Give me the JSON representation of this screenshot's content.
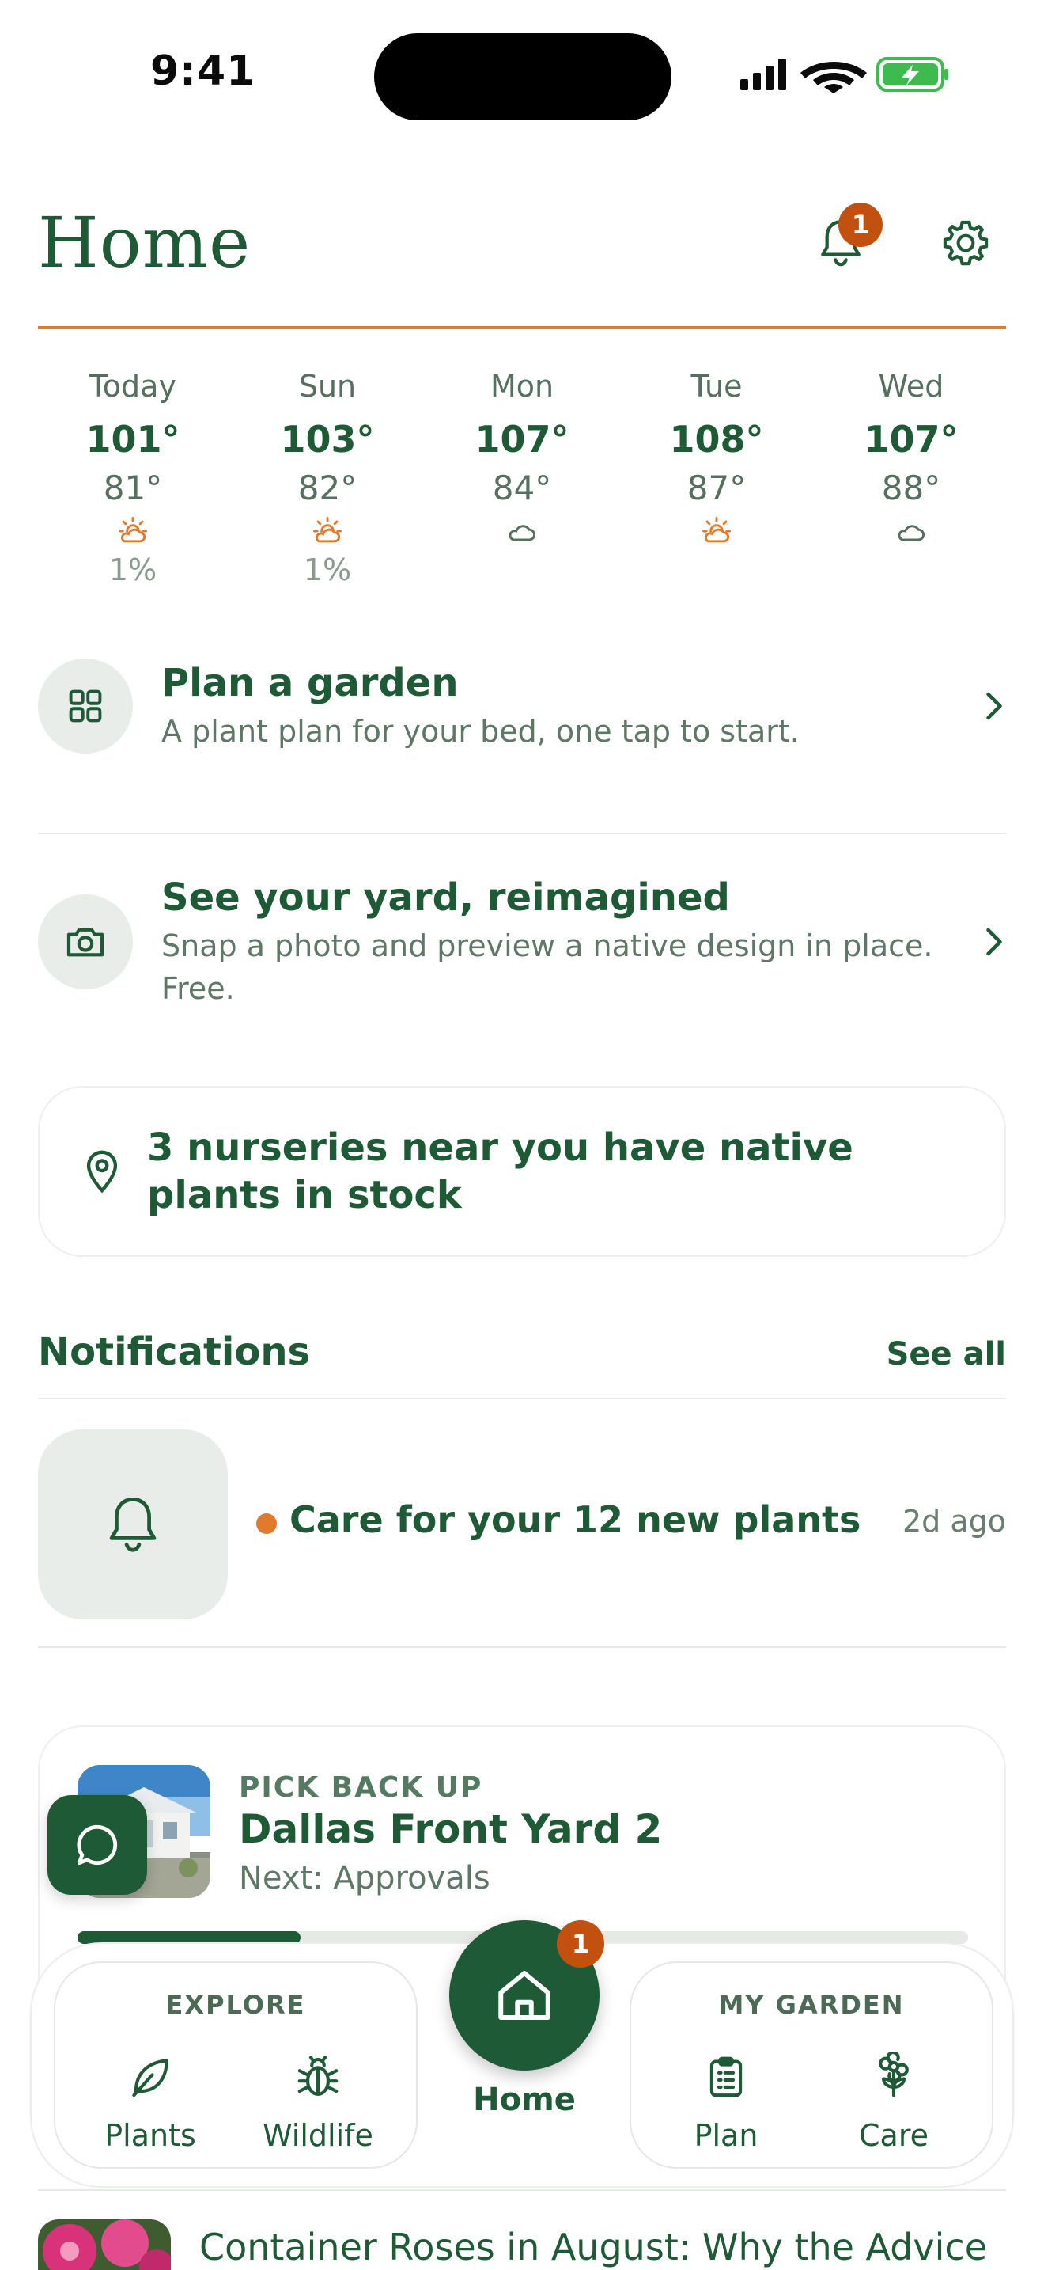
{
  "status_bar": {
    "time": "9:41"
  },
  "header": {
    "title": "Home",
    "notifications_count": "1"
  },
  "weather": [
    {
      "day": "Today",
      "high": "101°",
      "low": "81°",
      "icon": "sun-cloud-icon",
      "precip": "1%"
    },
    {
      "day": "Sun",
      "high": "103°",
      "low": "82°",
      "icon": "sun-cloud-icon",
      "precip": "1%"
    },
    {
      "day": "Mon",
      "high": "107°",
      "low": "84°",
      "icon": "cloud-icon",
      "precip": ""
    },
    {
      "day": "Tue",
      "high": "108°",
      "low": "87°",
      "icon": "sun-cloud-icon",
      "precip": ""
    },
    {
      "day": "Wed",
      "high": "107°",
      "low": "88°",
      "icon": "cloud-icon",
      "precip": ""
    }
  ],
  "actions": [
    {
      "title": "Plan a garden",
      "subtitle": "A plant plan for your bed, one tap to start.",
      "icon": "grid-icon"
    },
    {
      "title": "See your yard, reimagined",
      "subtitle": "Snap a photo and preview a native design in place. Free.",
      "icon": "camera-icon"
    }
  ],
  "nurseries": {
    "text": "3 nurseries near you have native plants in stock",
    "icon": "location-pin-icon"
  },
  "notifications": {
    "title": "Notifications",
    "see_all": "See all",
    "items": [
      {
        "text": "Care for your 12 new plants",
        "time": "2d ago",
        "icon": "bell-icon"
      }
    ]
  },
  "project": {
    "kicker": "PICK BACK UP",
    "name": "Dallas Front Yard 2",
    "next": "Next: Approvals",
    "progress": 0.25
  },
  "article": {
    "title": "Container Roses in August: Why the Advice"
  },
  "nav": {
    "explore_label": "EXPLORE",
    "my_garden_label": "MY GARDEN",
    "items": {
      "plants": "Plants",
      "wildlife": "Wildlife",
      "home": "Home",
      "plan": "Plan",
      "care": "Care"
    },
    "home_badge": "1"
  },
  "colors": {
    "primary": "#1f5a36",
    "accent": "#e07a2e",
    "badge": "#c2500e"
  }
}
